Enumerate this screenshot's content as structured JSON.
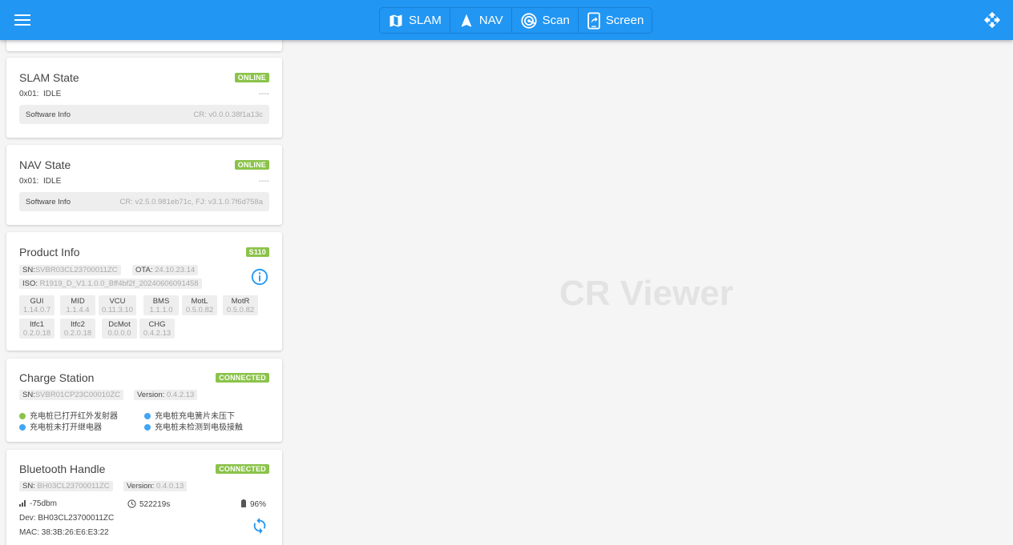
{
  "topbar": {
    "menu_icon": "hamburger-icon",
    "move_icon": "move-arrows-icon",
    "buttons": [
      {
        "label": "SLAM",
        "icon": "map-icon"
      },
      {
        "label": "NAV",
        "icon": "navigation-arrow-icon"
      },
      {
        "label": "Scan",
        "icon": "scan-radar-icon"
      },
      {
        "label": "Screen",
        "icon": "screen-share-icon"
      }
    ]
  },
  "slam": {
    "title": "SLAM State",
    "status": "ONLINE",
    "code": "0x01:",
    "state": "IDLE",
    "right": "----",
    "software_label": "Software Info",
    "software_value": "CR: v0.0.0.38f1a13c"
  },
  "nav": {
    "title": "NAV State",
    "status": "ONLINE",
    "code": "0x01:",
    "state": "IDLE",
    "right": "----",
    "software_label": "Software Info",
    "software_value": "CR: v2.5.0.981eb71c, FJ: v3.1.0.7f6d758a"
  },
  "product": {
    "title": "Product Info",
    "model": "S110",
    "sn_label": "SN:",
    "sn": "SVBR03CL23700011ZC",
    "ota_label": "OTA:",
    "ota": "24.10.23.14",
    "iso_label": "ISO:",
    "iso": "R1919_D_V1.1.0.0_Bff4bf2f_20240606091458",
    "info_icon": "info-circle-icon",
    "modules": [
      {
        "name": "GUI",
        "version": "1.14.0.7"
      },
      {
        "name": "MID",
        "version": "1.1.4.4"
      },
      {
        "name": "VCU",
        "version": "0.11.3.10"
      },
      {
        "name": "BMS",
        "version": "1.1.1.0"
      },
      {
        "name": "MotL",
        "version": "0.5.0.82"
      },
      {
        "name": "MotR",
        "version": "0.5.0.82"
      },
      {
        "name": "Itfc1",
        "version": "0.2.0.18"
      },
      {
        "name": "Itfc2",
        "version": "0.2.0.18"
      },
      {
        "name": "DcMot",
        "version": "0.0.0.0"
      },
      {
        "name": "CHG",
        "version": "0.4.2.13"
      }
    ]
  },
  "charge": {
    "title": "Charge Station",
    "status": "CONNECTED",
    "sn_label": "SN:",
    "sn": "SVBR01CP23C00010ZC",
    "version_label": "Version:",
    "version": "0.4.2.13",
    "items": [
      {
        "text": "充电桩已打开红外发射器",
        "color": "#8bc34a"
      },
      {
        "text": "充电桩充电簧片未压下",
        "color": "#42a5f5"
      },
      {
        "text": "充电桩未打开继电器",
        "color": "#42a5f5"
      },
      {
        "text": "充电桩未检测到电极接触",
        "color": "#42a5f5"
      }
    ]
  },
  "bluetooth": {
    "title": "Bluetooth Handle",
    "status": "CONNECTED",
    "sn_label": "SN:",
    "sn": "BH03CL23700011ZC",
    "version_label": "Version:",
    "version": "0.4.0.13",
    "signal": "-75dbm",
    "uptime": "522219s",
    "battery": "96%",
    "dev": "Dev: BH03CL23700011ZC",
    "mac": "MAC: 38:3B:26:E6:E3:22",
    "refresh_icon": "refresh-icon"
  },
  "main": {
    "watermark": "CR Viewer"
  },
  "colors": {
    "primary": "#2196f3",
    "online": "#8bc34a",
    "info": "#42a5f5"
  }
}
